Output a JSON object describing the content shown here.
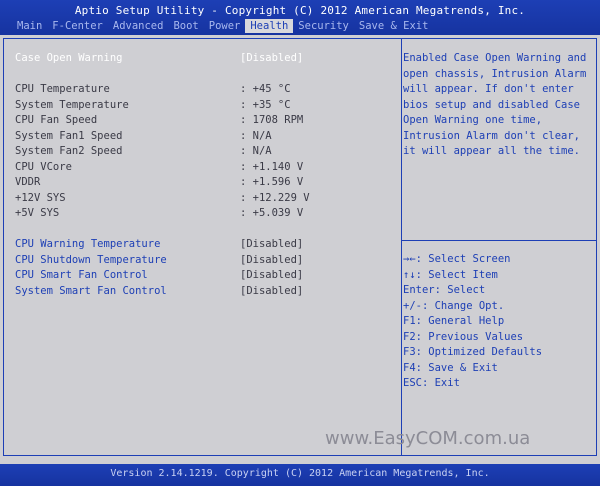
{
  "header": {
    "title": "Aptio Setup Utility - Copyright (C) 2012 American Megatrends, Inc.",
    "menu": [
      "Main",
      "F-Center",
      "Advanced",
      "Boot",
      "Power",
      "Health",
      "Security",
      "Save & Exit"
    ],
    "active_index": 5
  },
  "settings": {
    "case_open": {
      "label": "Case Open Warning",
      "value": "[Disabled]"
    },
    "readings": [
      {
        "label": "CPU Temperature",
        "value": ": +45 °C"
      },
      {
        "label": "System Temperature",
        "value": ": +35 °C"
      },
      {
        "label": "CPU Fan Speed",
        "value": ": 1708 RPM"
      },
      {
        "label": "System Fan1 Speed",
        "value": ": N/A"
      },
      {
        "label": "System Fan2 Speed",
        "value": ": N/A"
      },
      {
        "label": "CPU VCore",
        "value": ": +1.140 V"
      },
      {
        "label": "VDDR",
        "value": ": +1.596 V"
      },
      {
        "label": "+12V SYS",
        "value": ": +12.229 V"
      },
      {
        "label": "+5V SYS",
        "value": ": +5.039 V"
      }
    ],
    "controls": [
      {
        "label": "CPU Warning Temperature",
        "value": "[Disabled]"
      },
      {
        "label": "CPU Shutdown Temperature",
        "value": "[Disabled]"
      },
      {
        "label": "CPU Smart Fan Control",
        "value": "[Disabled]"
      },
      {
        "label": "System Smart Fan Control",
        "value": "[Disabled]"
      }
    ]
  },
  "help": {
    "text": "Enabled Case Open Warning and\nopen chassis, Intrusion Alarm\nwill appear. If don't enter\nbios setup and disabled Case\nOpen Warning one time,\nIntrusion Alarm don't clear,\nit will appear all the time."
  },
  "keys": [
    "→←: Select Screen",
    "↑↓: Select Item",
    "Enter: Select",
    "+/-: Change Opt.",
    "F1: General Help",
    "F2: Previous Values",
    "F3: Optimized Defaults",
    "F4: Save & Exit",
    "ESC: Exit"
  ],
  "watermark": "www.EasyCOM.com.ua",
  "footer": "Version 2.14.1219. Copyright (C) 2012 American Megatrends, Inc.",
  "colors": {
    "bar": "#1d3fb5",
    "panel": "#cfcfd3",
    "text": "#3a3a46",
    "accent": "#1d3fb5",
    "selected": "#ffffff"
  }
}
